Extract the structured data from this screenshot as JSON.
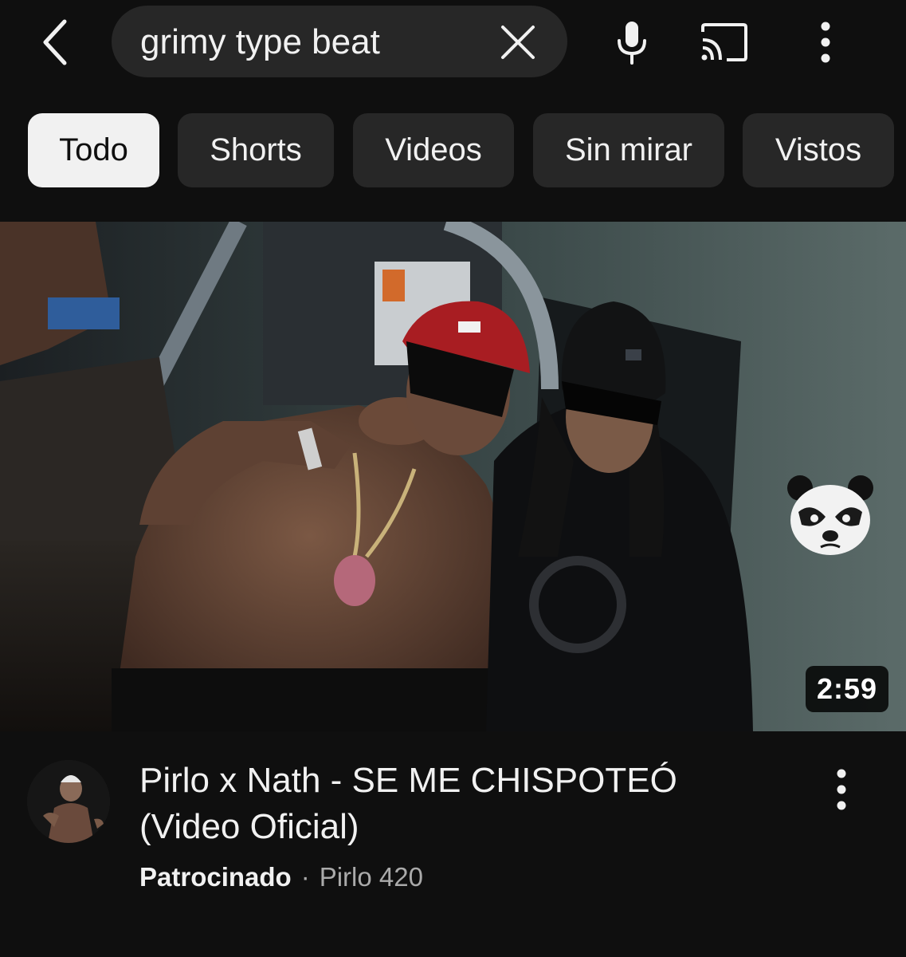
{
  "search": {
    "query": "grimy type beat"
  },
  "icons": {
    "back": "chevron-left-icon",
    "clear": "close-icon",
    "mic": "microphone-icon",
    "cast": "cast-icon",
    "more": "more-vertical-icon"
  },
  "chips": [
    {
      "label": "Todo",
      "active": true
    },
    {
      "label": "Shorts",
      "active": false
    },
    {
      "label": "Videos",
      "active": false
    },
    {
      "label": "Sin mirar",
      "active": false
    },
    {
      "label": "Vistos",
      "active": false
    }
  ],
  "video": {
    "duration": "2:59",
    "title": "Pirlo x Nath - SE ME CHISPOTEÓ (Video Oficial)",
    "sponsored_label": "Patrocinado",
    "separator": "·",
    "channel": "Pirlo 420"
  },
  "colors": {
    "background": "#0f0f0f",
    "chip_bg": "#272727",
    "chip_active_bg": "#f1f1f1",
    "text_primary": "#f1f1f1",
    "text_secondary": "#aaaaaa"
  }
}
